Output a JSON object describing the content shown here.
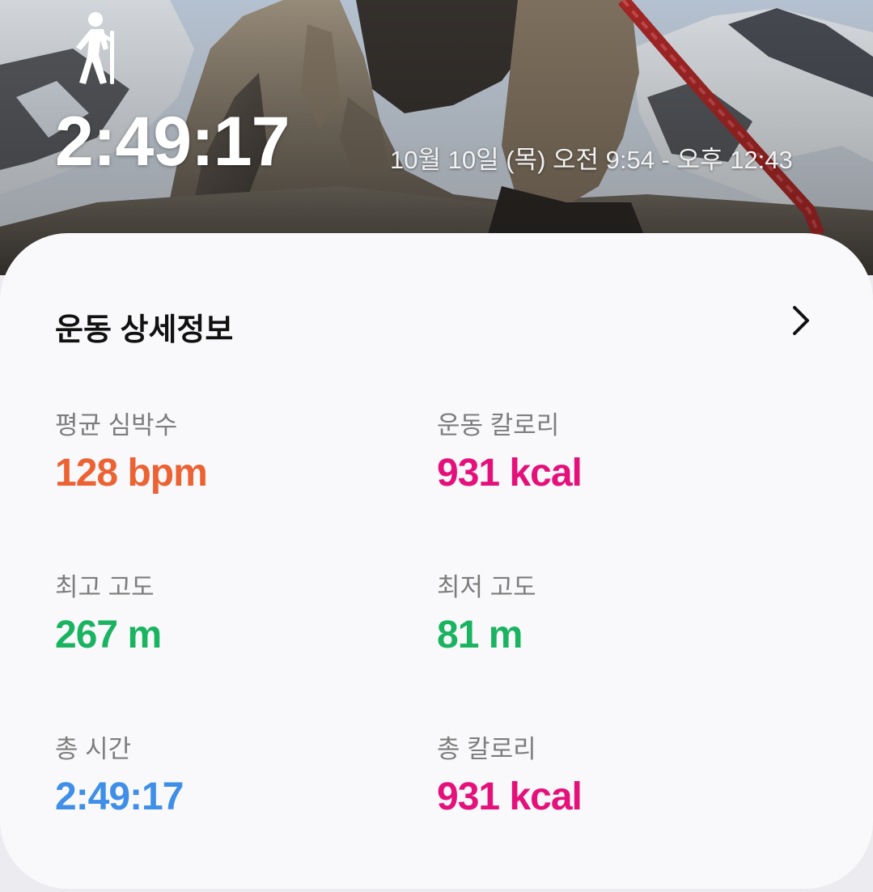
{
  "header": {
    "activity_icon": "hiking-person-icon",
    "duration": "2:49:17",
    "time_range": "10월 10일 (목) 오전 9:54 - 오후 12:43"
  },
  "details": {
    "title": "운동 상세정보",
    "chevron_icon": "chevron-right-icon",
    "stats": {
      "avg_heart_rate": {
        "label": "평균 심박수",
        "value": "128",
        "unit": "bpm"
      },
      "workout_calories": {
        "label": "운동 칼로리",
        "value": "931",
        "unit": "kcal"
      },
      "max_altitude": {
        "label": "최고 고도",
        "value": "267",
        "unit": "m"
      },
      "min_altitude": {
        "label": "최저 고도",
        "value": "81",
        "unit": "m"
      },
      "total_time": {
        "label": "총 시간",
        "value": "2:49:17",
        "unit": ""
      },
      "total_calories": {
        "label": "총 칼로리",
        "value": "931",
        "unit": "kcal"
      }
    }
  },
  "colors": {
    "heart_rate": "#ec6232",
    "calories": "#e5107a",
    "altitude": "#1ab360",
    "time": "#3f8fe8",
    "card_background": "#f9f9fc"
  }
}
